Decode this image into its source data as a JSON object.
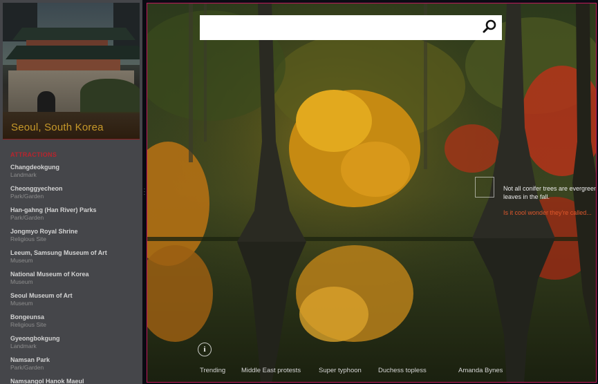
{
  "colors": {
    "accent_red": "#b8242d",
    "hero_title": "#c7992a",
    "link_orange": "#e0582c",
    "pane_border": "#c2185b"
  },
  "travel": {
    "hero_title": "Seoul, South Korea",
    "section_title": "ATTRACTIONS",
    "attractions": [
      {
        "name": "Changdeokgung",
        "type": "Landmark"
      },
      {
        "name": "Cheonggyecheon",
        "type": "Park/Garden"
      },
      {
        "name": "Han-gahng (Han River) Parks",
        "type": "Park/Garden"
      },
      {
        "name": "Jongmyo Royal Shrine",
        "type": "Religious Site"
      },
      {
        "name": "Leeum, Samsung Museum of Art",
        "type": "Museum"
      },
      {
        "name": "National Museum of Korea",
        "type": "Museum"
      },
      {
        "name": "Seoul Museum of Art",
        "type": "Museum"
      },
      {
        "name": "Bongeunsa",
        "type": "Religious Site"
      },
      {
        "name": "Gyeongbokgung",
        "type": "Landmark"
      },
      {
        "name": "Namsan Park",
        "type": "Park/Garden"
      },
      {
        "name": "Namsangol Hanok Maeul",
        "type": ""
      }
    ]
  },
  "bing": {
    "search": {
      "value": "",
      "icon": "search-icon"
    },
    "hotspot": {
      "fact": "Not all conifer trees are evergreens. Some lose their",
      "fact_line2": "leaves in the fall.",
      "link": "Is it cool wonder they're called..."
    },
    "info_icon_label": "i",
    "trending": [
      "Trending",
      "Middle East protests",
      "Super typhoon",
      "Duchess topless",
      "Amanda Bynes"
    ]
  }
}
